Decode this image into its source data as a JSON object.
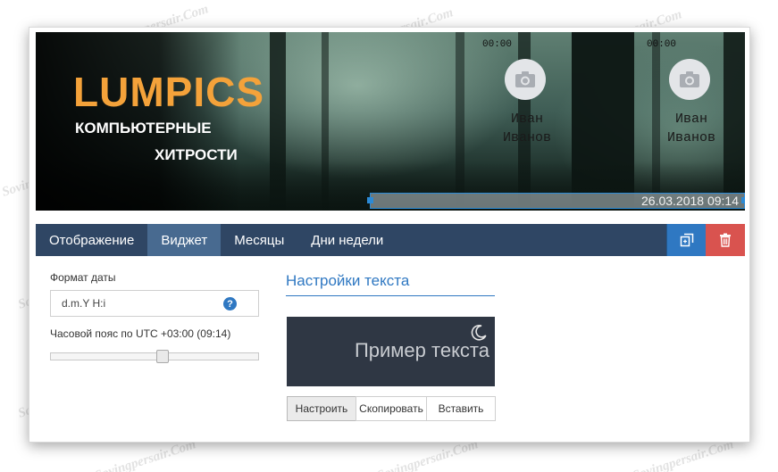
{
  "banner": {
    "logo_title": "LUMPICS",
    "logo_sub1": "КОМПЬЮТЕРНЫЕ",
    "logo_sub2": "ХИТРОСТИ",
    "cam1": {
      "time": "00:00",
      "name_line1": "Иван",
      "name_line2": "Иванов"
    },
    "cam2": {
      "time": "00:00",
      "name_line1": "Иван",
      "name_line2": "Иванов"
    },
    "datetime": "26.03.2018 09:14"
  },
  "nav": {
    "tabs": [
      {
        "label": "Отображение",
        "active": false
      },
      {
        "label": "Виджет",
        "active": true
      },
      {
        "label": "Месяцы",
        "active": false
      },
      {
        "label": "Дни недели",
        "active": false
      }
    ],
    "copy_icon": "copy-icon",
    "delete_icon": "trash-icon"
  },
  "settings": {
    "date_format_label": "Формат даты",
    "date_format_value": "d.m.Y H:i",
    "help_glyph": "?",
    "timezone_label": "Часовой пояс по UTC +03:00 (09:14)",
    "timezone_slider_fraction": 0.54
  },
  "text_settings": {
    "title": "Настройки текста",
    "preview_text": "Пример текста",
    "buttons": {
      "configure": "Настроить",
      "copy": "Скопировать",
      "paste": "Вставить"
    }
  },
  "watermark": "Sovingpersair.Com",
  "colors": {
    "accent_blue": "#2f78c2",
    "nav_bg": "#2f4664",
    "nav_active": "#486a90",
    "danger": "#d9534f",
    "logo_orange": "#f4a23a"
  }
}
